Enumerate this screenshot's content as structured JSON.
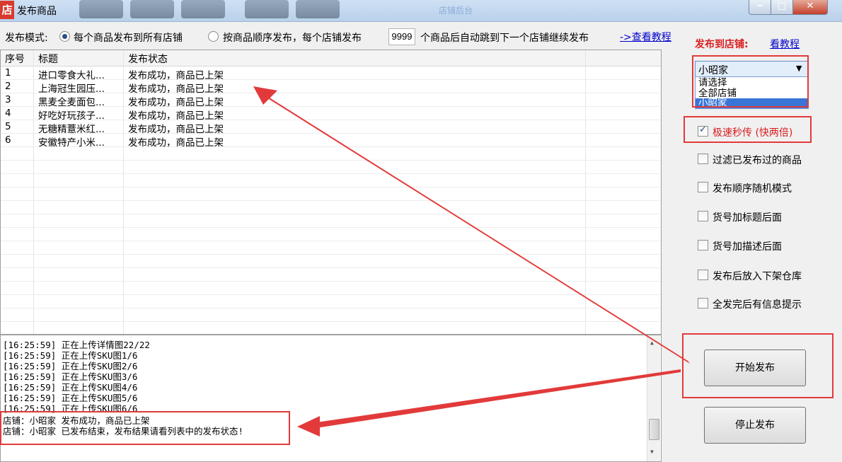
{
  "window": {
    "icon_char": "店",
    "title": "发布商品",
    "min_glyph": "−",
    "max_glyph": "□",
    "close_glyph": "✕",
    "faded_link": "店铺后台"
  },
  "mode": {
    "label": "发布模式:",
    "option_all": "每个商品发布到所有店铺",
    "option_seq": "按商品顺序发布，每个店铺发布",
    "count_value": "9999",
    "suffix": "个商品后自动跳到下一个店铺继续发布",
    "tutorial_link": "->查看教程"
  },
  "grid": {
    "columns": [
      "序号",
      "标题",
      "发布状态"
    ],
    "rows": [
      [
        "1",
        "进口零食大礼...",
        "发布成功，商品已上架"
      ],
      [
        "2",
        "上海冠生园压...",
        "发布成功，商品已上架"
      ],
      [
        "3",
        "黑麦全麦面包...",
        "发布成功，商品已上架"
      ],
      [
        "4",
        "好吃好玩孩子...",
        "发布成功，商品已上架"
      ],
      [
        "5",
        "无糖精薏米红...",
        "发布成功，商品已上架"
      ],
      [
        "6",
        "安徽特产小米...",
        "发布成功，商品已上架"
      ]
    ]
  },
  "log": {
    "lines": [
      "[16:25:59] 正在上传详情图22/22",
      "[16:25:59] 正在上传SKU图1/6",
      "[16:25:59] 正在上传SKU图2/6",
      "[16:25:59] 正在上传SKU图3/6",
      "[16:25:59] 正在上传SKU图4/6",
      "[16:25:59] 正在上传SKU图5/6",
      "[16:25:59] 正在上传SKU图6/6",
      "店铺：小昭家 发布成功，商品已上架",
      "店铺：小昭家 已发布结束，发布结果请看列表中的发布状态!"
    ]
  },
  "panel": {
    "publish_to_label": "发布到店铺:",
    "tutorial_link": "看教程",
    "selected_store": "小昭家",
    "dropdown_options": [
      "请选择",
      "全部店铺",
      "小昭家"
    ],
    "options": [
      {
        "label": "极速秒传 (快两倍)",
        "checked": true
      },
      {
        "label": "过滤已发布过的商品",
        "checked": false
      },
      {
        "label": "发布顺序随机模式",
        "checked": false
      },
      {
        "label": "货号加标题后面",
        "checked": false
      },
      {
        "label": "货号加描述后面",
        "checked": false
      },
      {
        "label": "发布后放入下架仓库",
        "checked": false
      },
      {
        "label": "全发完后有信息提示",
        "checked": false
      }
    ],
    "start_button": "开始发布",
    "stop_button": "停止发布"
  },
  "colors": {
    "annotation_red": "#e23a3a",
    "highlight_blue": "#3875d7"
  }
}
